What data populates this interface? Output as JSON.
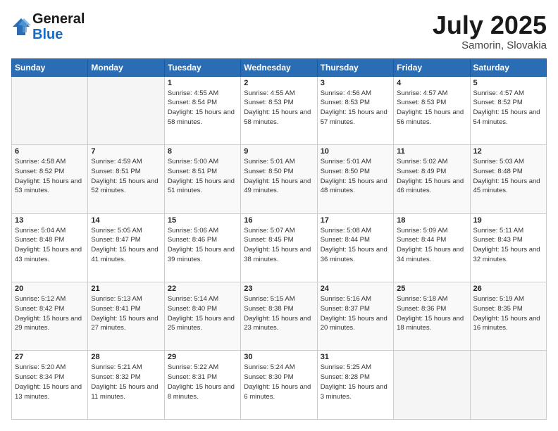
{
  "logo": {
    "general": "General",
    "blue": "Blue"
  },
  "title": {
    "month_year": "July 2025",
    "location": "Samorin, Slovakia"
  },
  "days_header": [
    "Sunday",
    "Monday",
    "Tuesday",
    "Wednesday",
    "Thursday",
    "Friday",
    "Saturday"
  ],
  "weeks": [
    [
      {
        "day": "",
        "sunrise": "",
        "sunset": "",
        "daylight": ""
      },
      {
        "day": "",
        "sunrise": "",
        "sunset": "",
        "daylight": ""
      },
      {
        "day": "1",
        "sunrise": "Sunrise: 4:55 AM",
        "sunset": "Sunset: 8:54 PM",
        "daylight": "Daylight: 15 hours and 58 minutes."
      },
      {
        "day": "2",
        "sunrise": "Sunrise: 4:55 AM",
        "sunset": "Sunset: 8:53 PM",
        "daylight": "Daylight: 15 hours and 58 minutes."
      },
      {
        "day": "3",
        "sunrise": "Sunrise: 4:56 AM",
        "sunset": "Sunset: 8:53 PM",
        "daylight": "Daylight: 15 hours and 57 minutes."
      },
      {
        "day": "4",
        "sunrise": "Sunrise: 4:57 AM",
        "sunset": "Sunset: 8:53 PM",
        "daylight": "Daylight: 15 hours and 56 minutes."
      },
      {
        "day": "5",
        "sunrise": "Sunrise: 4:57 AM",
        "sunset": "Sunset: 8:52 PM",
        "daylight": "Daylight: 15 hours and 54 minutes."
      }
    ],
    [
      {
        "day": "6",
        "sunrise": "Sunrise: 4:58 AM",
        "sunset": "Sunset: 8:52 PM",
        "daylight": "Daylight: 15 hours and 53 minutes."
      },
      {
        "day": "7",
        "sunrise": "Sunrise: 4:59 AM",
        "sunset": "Sunset: 8:51 PM",
        "daylight": "Daylight: 15 hours and 52 minutes."
      },
      {
        "day": "8",
        "sunrise": "Sunrise: 5:00 AM",
        "sunset": "Sunset: 8:51 PM",
        "daylight": "Daylight: 15 hours and 51 minutes."
      },
      {
        "day": "9",
        "sunrise": "Sunrise: 5:01 AM",
        "sunset": "Sunset: 8:50 PM",
        "daylight": "Daylight: 15 hours and 49 minutes."
      },
      {
        "day": "10",
        "sunrise": "Sunrise: 5:01 AM",
        "sunset": "Sunset: 8:50 PM",
        "daylight": "Daylight: 15 hours and 48 minutes."
      },
      {
        "day": "11",
        "sunrise": "Sunrise: 5:02 AM",
        "sunset": "Sunset: 8:49 PM",
        "daylight": "Daylight: 15 hours and 46 minutes."
      },
      {
        "day": "12",
        "sunrise": "Sunrise: 5:03 AM",
        "sunset": "Sunset: 8:48 PM",
        "daylight": "Daylight: 15 hours and 45 minutes."
      }
    ],
    [
      {
        "day": "13",
        "sunrise": "Sunrise: 5:04 AM",
        "sunset": "Sunset: 8:48 PM",
        "daylight": "Daylight: 15 hours and 43 minutes."
      },
      {
        "day": "14",
        "sunrise": "Sunrise: 5:05 AM",
        "sunset": "Sunset: 8:47 PM",
        "daylight": "Daylight: 15 hours and 41 minutes."
      },
      {
        "day": "15",
        "sunrise": "Sunrise: 5:06 AM",
        "sunset": "Sunset: 8:46 PM",
        "daylight": "Daylight: 15 hours and 39 minutes."
      },
      {
        "day": "16",
        "sunrise": "Sunrise: 5:07 AM",
        "sunset": "Sunset: 8:45 PM",
        "daylight": "Daylight: 15 hours and 38 minutes."
      },
      {
        "day": "17",
        "sunrise": "Sunrise: 5:08 AM",
        "sunset": "Sunset: 8:44 PM",
        "daylight": "Daylight: 15 hours and 36 minutes."
      },
      {
        "day": "18",
        "sunrise": "Sunrise: 5:09 AM",
        "sunset": "Sunset: 8:44 PM",
        "daylight": "Daylight: 15 hours and 34 minutes."
      },
      {
        "day": "19",
        "sunrise": "Sunrise: 5:11 AM",
        "sunset": "Sunset: 8:43 PM",
        "daylight": "Daylight: 15 hours and 32 minutes."
      }
    ],
    [
      {
        "day": "20",
        "sunrise": "Sunrise: 5:12 AM",
        "sunset": "Sunset: 8:42 PM",
        "daylight": "Daylight: 15 hours and 29 minutes."
      },
      {
        "day": "21",
        "sunrise": "Sunrise: 5:13 AM",
        "sunset": "Sunset: 8:41 PM",
        "daylight": "Daylight: 15 hours and 27 minutes."
      },
      {
        "day": "22",
        "sunrise": "Sunrise: 5:14 AM",
        "sunset": "Sunset: 8:40 PM",
        "daylight": "Daylight: 15 hours and 25 minutes."
      },
      {
        "day": "23",
        "sunrise": "Sunrise: 5:15 AM",
        "sunset": "Sunset: 8:38 PM",
        "daylight": "Daylight: 15 hours and 23 minutes."
      },
      {
        "day": "24",
        "sunrise": "Sunrise: 5:16 AM",
        "sunset": "Sunset: 8:37 PM",
        "daylight": "Daylight: 15 hours and 20 minutes."
      },
      {
        "day": "25",
        "sunrise": "Sunrise: 5:18 AM",
        "sunset": "Sunset: 8:36 PM",
        "daylight": "Daylight: 15 hours and 18 minutes."
      },
      {
        "day": "26",
        "sunrise": "Sunrise: 5:19 AM",
        "sunset": "Sunset: 8:35 PM",
        "daylight": "Daylight: 15 hours and 16 minutes."
      }
    ],
    [
      {
        "day": "27",
        "sunrise": "Sunrise: 5:20 AM",
        "sunset": "Sunset: 8:34 PM",
        "daylight": "Daylight: 15 hours and 13 minutes."
      },
      {
        "day": "28",
        "sunrise": "Sunrise: 5:21 AM",
        "sunset": "Sunset: 8:32 PM",
        "daylight": "Daylight: 15 hours and 11 minutes."
      },
      {
        "day": "29",
        "sunrise": "Sunrise: 5:22 AM",
        "sunset": "Sunset: 8:31 PM",
        "daylight": "Daylight: 15 hours and 8 minutes."
      },
      {
        "day": "30",
        "sunrise": "Sunrise: 5:24 AM",
        "sunset": "Sunset: 8:30 PM",
        "daylight": "Daylight: 15 hours and 6 minutes."
      },
      {
        "day": "31",
        "sunrise": "Sunrise: 5:25 AM",
        "sunset": "Sunset: 8:28 PM",
        "daylight": "Daylight: 15 hours and 3 minutes."
      },
      {
        "day": "",
        "sunrise": "",
        "sunset": "",
        "daylight": ""
      },
      {
        "day": "",
        "sunrise": "",
        "sunset": "",
        "daylight": ""
      }
    ]
  ]
}
